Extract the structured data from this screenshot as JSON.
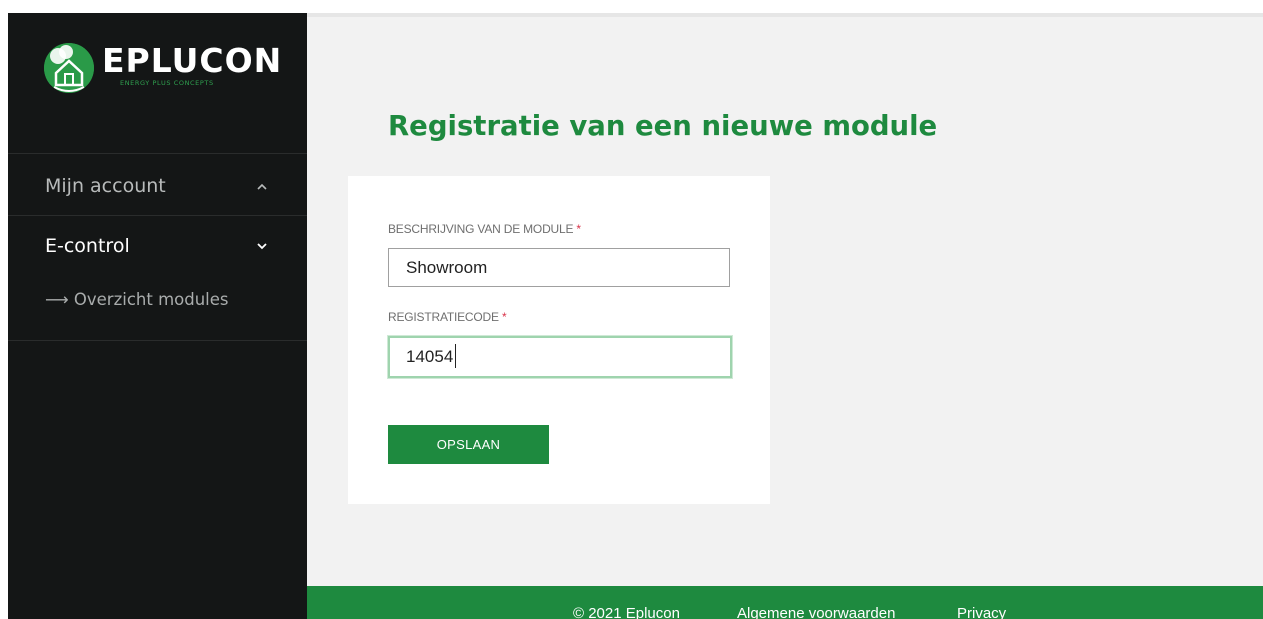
{
  "brand": {
    "name": "EPLUCON",
    "tagline": "ENERGY PLUS CONCEPTS",
    "accent": "#1e8a3f",
    "sidebar_bg": "#141616"
  },
  "sidebar": {
    "items": [
      {
        "label": "Mijn account",
        "icon": "chevron-up-icon",
        "expanded": false
      },
      {
        "label": "E-control",
        "icon": "chevron-down-icon",
        "expanded": true,
        "children": [
          {
            "label": "Overzicht modules",
            "icon": "arrow-right-icon"
          }
        ]
      }
    ]
  },
  "main": {
    "title": "Registratie van een nieuwe module",
    "form": {
      "description_label": "BESCHRIJVING VAN DE MODULE",
      "description_value": "Showroom",
      "code_label": "REGISTRATIECODE",
      "code_value": "14054",
      "required_marker": "*",
      "submit_label": "OPSLAAN"
    }
  },
  "footer": {
    "copyright": "© 2021 Eplucon",
    "terms": "Algemene voorwaarden",
    "privacy": "Privacy"
  }
}
